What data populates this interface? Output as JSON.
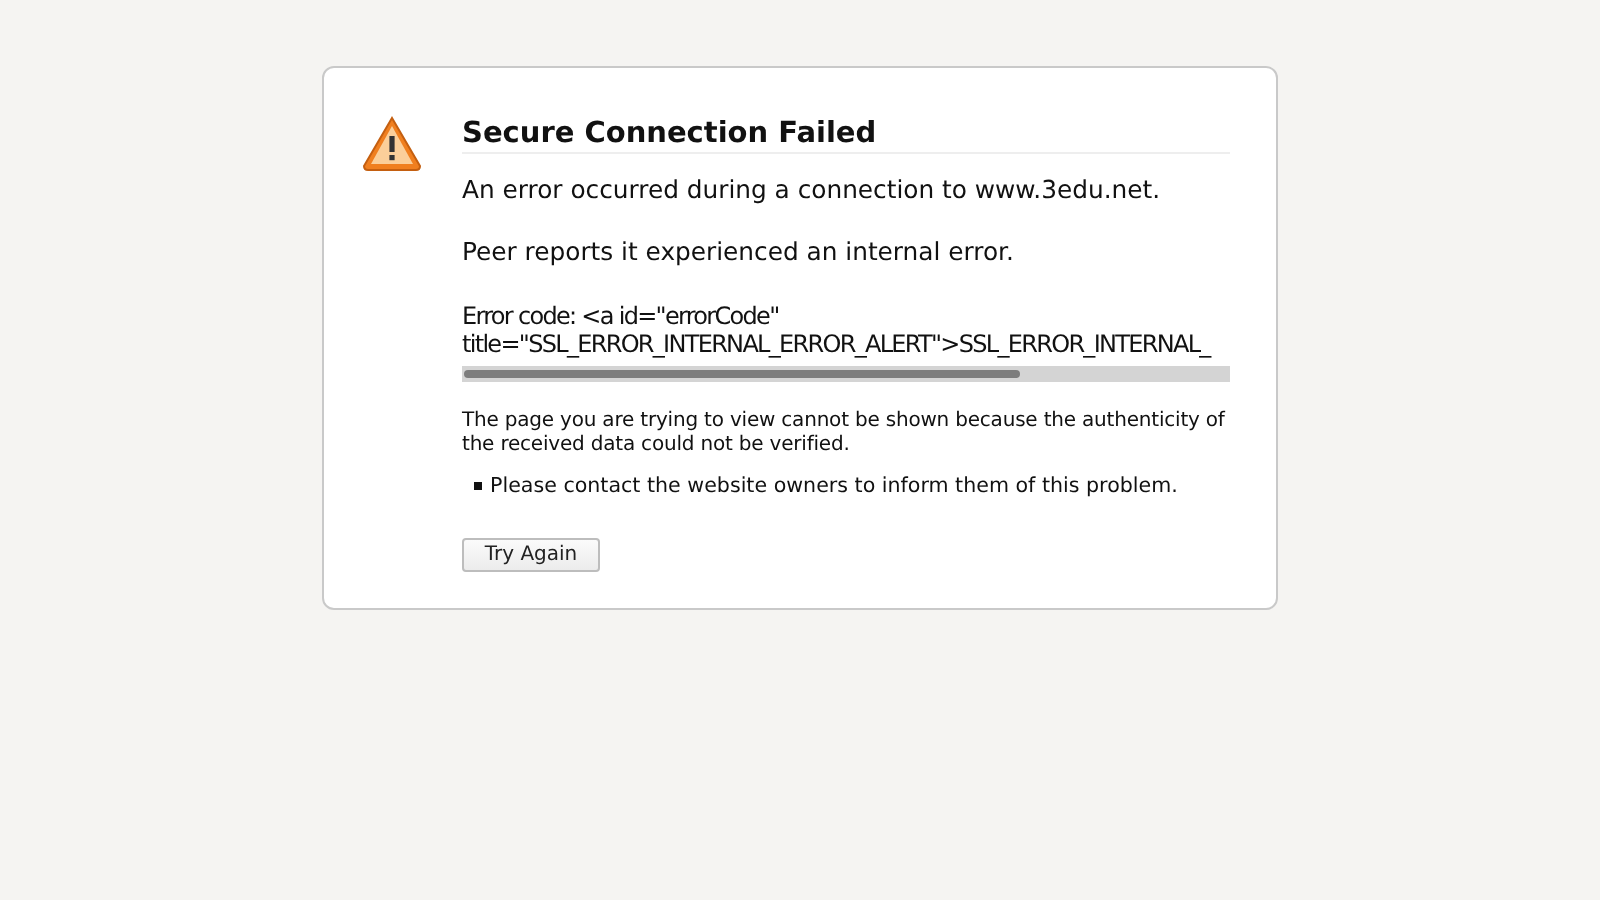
{
  "title": "Secure Connection Failed",
  "paragraphs": [
    "An error occurred during a connection to www.3edu.net.",
    "Peer reports it experienced an internal error."
  ],
  "error_code": "Error code: <a id=\"errorCode\" title=\"SSL_ERROR_INTERNAL_ERROR_ALERT\">SSL_ERROR_INTERNAL_",
  "description": "The page you are trying to view cannot be shown because the authenticity of the received data could not be verified.",
  "bullets": [
    "Please contact the website owners to inform them of this problem."
  ],
  "button": "Try Again"
}
